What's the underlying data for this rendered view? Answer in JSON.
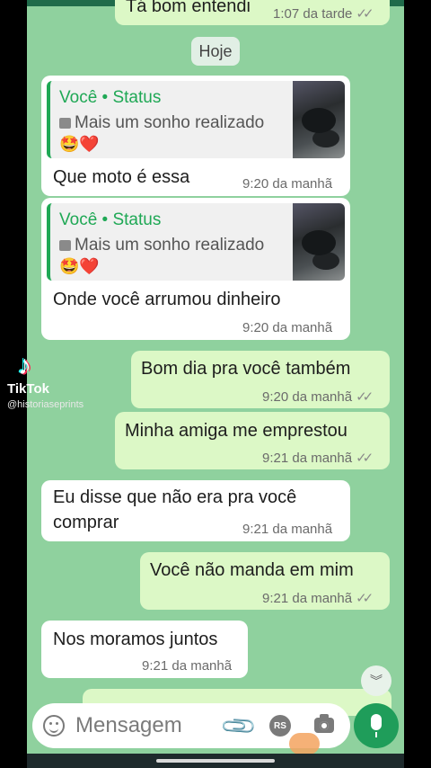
{
  "chat": {
    "prev_message": {
      "text": "Tá bom entendi",
      "time": "1:07 da tarde",
      "ticks": "✓✓"
    },
    "day_separator": "Hoje",
    "messages": [
      {
        "type": "reply",
        "quote_author": "Você • Status",
        "quote_text": "Mais um sonho realizado",
        "quote_emoji": "🤩❤️",
        "text": "Que moto é essa",
        "time": "9:20 da manhã"
      },
      {
        "type": "reply",
        "quote_author": "Você • Status",
        "quote_text": "Mais um sonho realizado",
        "quote_emoji": "🤩❤️",
        "text": "Onde você arrumou dinheiro",
        "time": "9:20 da manhã"
      },
      {
        "type": "out",
        "text": "Bom dia pra você também",
        "time": "9:20 da manhã",
        "ticks": "✓✓"
      },
      {
        "type": "out",
        "text": "Minha amiga me emprestou",
        "time": "9:21 da manhã",
        "ticks": "✓✓"
      },
      {
        "type": "in",
        "text_line1": "Eu disse que não era pra você",
        "text_line2": "comprar",
        "time": "9:21 da manhã"
      },
      {
        "type": "out",
        "text": "Você não manda em mim",
        "time": "9:21 da manhã",
        "ticks": "✓✓"
      },
      {
        "type": "in",
        "text": "Nos moramos juntos",
        "time": "9:21 da manhã"
      }
    ]
  },
  "composer": {
    "placeholder": "Mensagem",
    "rs_label": "RS"
  },
  "watermark": {
    "brand": "TikTok",
    "user": "@historiaseprints"
  },
  "icons": [
    "emoji-icon",
    "attach-icon",
    "rs-icon",
    "camera-icon",
    "mic-icon",
    "chevron-double-down-icon",
    "tiktok-logo-icon",
    "photo-icon"
  ],
  "colors": {
    "chat_background": "#8fd19e",
    "outgoing_bubble": "#dcf8c6",
    "incoming_bubble": "#ffffff",
    "accent": "#1fa855",
    "mic_button": "#1f9d5a"
  }
}
